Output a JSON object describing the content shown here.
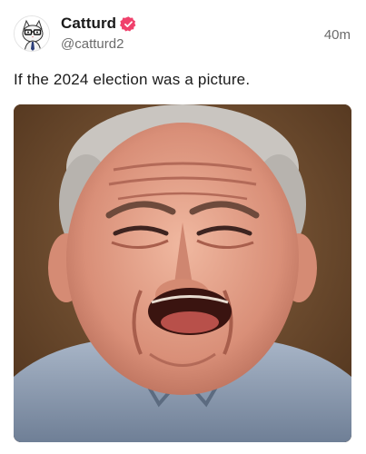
{
  "post": {
    "author": {
      "display_name": "Catturd",
      "handle": "@catturd2",
      "verified_icon": "verified-badge-icon",
      "verified_color": "#f0416c",
      "avatar_icon": "cat-avatar-icon"
    },
    "timestamp": "40m",
    "text": "If the 2024 election was a picture.",
    "media": {
      "type": "photo",
      "subject": "crying-man-photo"
    }
  }
}
